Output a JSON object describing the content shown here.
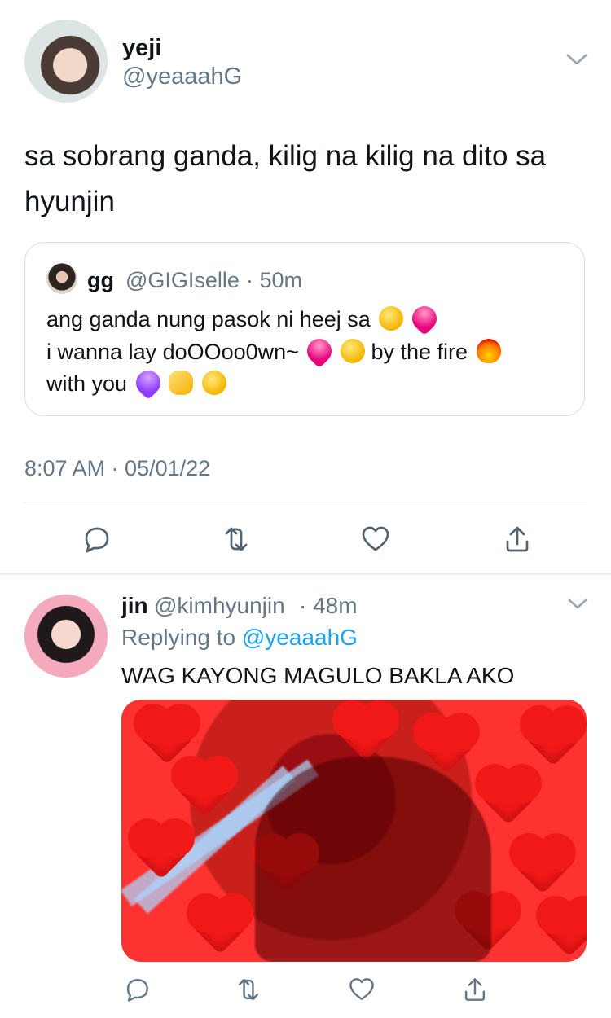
{
  "main_tweet": {
    "author": {
      "name": "yeji",
      "handle": "@yeaaahG"
    },
    "text": "sa sobrang ganda, kilig na kilig na dito sa hyunjin",
    "timestamp": "8:07 AM · 05/01/22",
    "quote": {
      "author_name": "gg",
      "author_handle": "@GIGIselle",
      "time": "· 50m",
      "lines": [
        "ang ganda nung pasok ni heej sa",
        "i wanna lay doOOoo0wn~",
        "by the fire",
        "with you"
      ]
    }
  },
  "reply_tweet": {
    "author": {
      "name": "jin",
      "handle": "@kimhyunjin",
      "time": "· 48m"
    },
    "replying_prefix": "Replying to",
    "replying_handle": "@yeaaahG",
    "text": "WAG KAYONG MAGULO BAKLA AKO"
  },
  "colors": {
    "text": "#0f1419",
    "muted": "#657786",
    "link": "#1da1f2",
    "divider": "#dfe4e8"
  },
  "icons": [
    "chevron-down-icon",
    "reply-icon",
    "retweet-icon",
    "like-icon",
    "share-icon"
  ]
}
